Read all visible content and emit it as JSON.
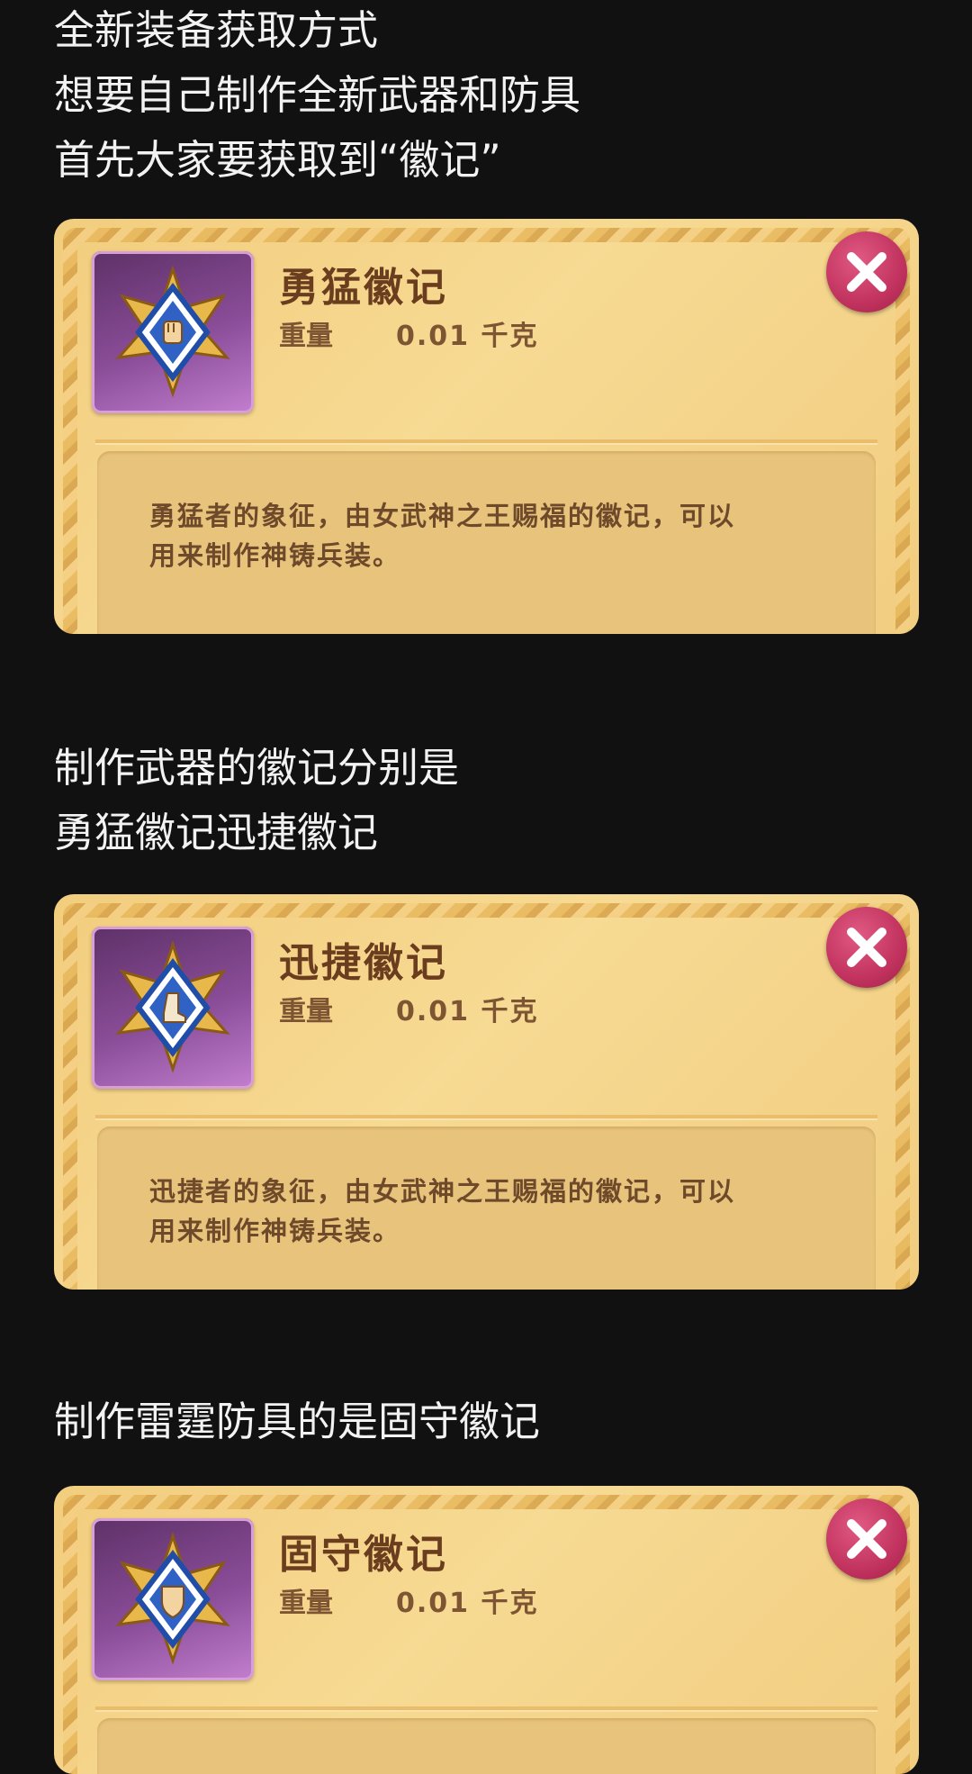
{
  "intro": {
    "lines": [
      "全新装备获取方式",
      "想要自己制作全新武器和防具",
      "首先大家要获取到“徽记”"
    ]
  },
  "section_weapons": {
    "lines": [
      "制作武器的徽记分别是",
      "勇猛徽记迅捷徽记"
    ]
  },
  "section_armor": {
    "lines": [
      "制作雷霆防具的是固守徽记"
    ]
  },
  "cards": [
    {
      "icon": "fist-emblem-icon",
      "title": "勇猛徽记",
      "weight_label": "重量",
      "weight_value": "0.01 千克",
      "desc_lines": [
        "勇猛者的象征，由女武神之王赐福的徽记，可以",
        "用来制作神铸兵装。"
      ]
    },
    {
      "icon": "boot-emblem-icon",
      "title": "迅捷徽记",
      "weight_label": "重量",
      "weight_value": "0.01 千克",
      "desc_lines": [
        "迅捷者的象征，由女武神之王赐福的徽记，可以",
        "用来制作神铸兵装。"
      ]
    },
    {
      "icon": "shield-emblem-icon",
      "title": "固守徽记",
      "weight_label": "重量",
      "weight_value": "0.01 千克",
      "desc_lines": []
    }
  ],
  "colors": {
    "background": "#111112",
    "text": "#f2f2f2",
    "card_gold": "#f7da93",
    "title_brown": "#6b3d1f",
    "close_red": "#c2335f",
    "icon_purple": "#8a4d98"
  }
}
